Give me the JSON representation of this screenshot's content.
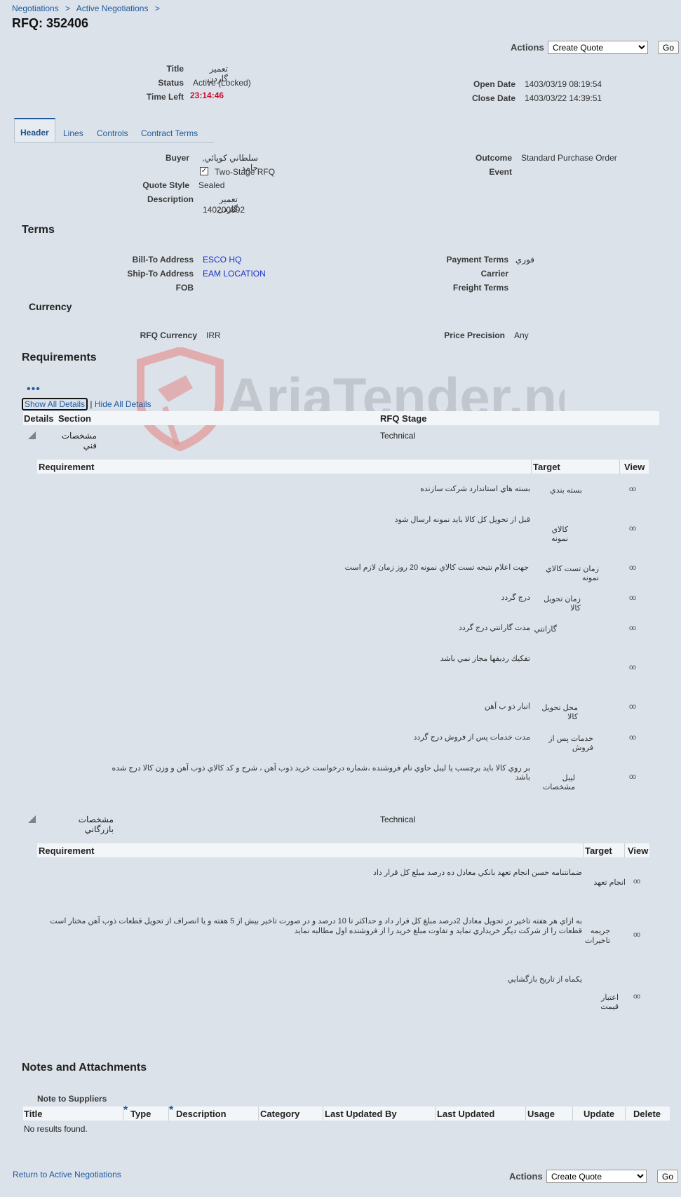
{
  "breadcrumb": [
    "Negotiations",
    "Active Negotiations"
  ],
  "breadcrumb_sep": ">",
  "page_title": "RFQ: 352406",
  "actions": {
    "label": "Actions",
    "selected": "Create Quote",
    "go": "Go"
  },
  "summary": {
    "title_label": "Title",
    "title_value": "تعمير گاردن",
    "status_label": "Status",
    "status_value": "Active (Locked)",
    "time_left_label": "Time Left",
    "time_left_value": "23:14:46",
    "open_date_label": "Open Date",
    "open_date_value": "1403/03/19 08:19:54",
    "close_date_label": "Close Date",
    "close_date_value": "1403/03/22 14:39:51"
  },
  "tabs": [
    "Header",
    "Lines",
    "Controls",
    "Contract Terms"
  ],
  "header": {
    "buyer_label": "Buyer",
    "buyer_value": "سلطاني كوپائي, حامد",
    "two_stage_label": "Two-Stage RFQ",
    "quote_style_label": "Quote Style",
    "quote_style_value": "Sealed",
    "description_label": "Description",
    "description_line1": "تعمير گاردن",
    "description_line2": "140200892",
    "outcome_label": "Outcome",
    "outcome_value": "Standard Purchase Order",
    "event_label": "Event"
  },
  "terms": {
    "title": "Terms",
    "bill_to_label": "Bill-To Address",
    "bill_to_value": "ESCO HQ",
    "ship_to_label": "Ship-To Address",
    "ship_to_value": "EAM LOCATION",
    "fob_label": "FOB",
    "payment_terms_label": "Payment Terms",
    "payment_terms_value": "فوري",
    "carrier_label": "Carrier",
    "freight_terms_label": "Freight Terms"
  },
  "currency": {
    "title": "Currency",
    "rfq_currency_label": "RFQ Currency",
    "rfq_currency_value": "IRR",
    "price_precision_label": "Price Precision",
    "price_precision_value": "Any"
  },
  "requirements": {
    "title": "Requirements",
    "show_all": "Show All Details",
    "hide_all": "Hide All Details",
    "pipe": "|",
    "col_details": "Details",
    "col_section": "Section",
    "col_stage": "RFQ Stage",
    "col_requirement": "Requirement",
    "col_target": "Target",
    "col_view": "View",
    "sections": [
      {
        "name": "مشخصات فني",
        "stage": "Technical",
        "rows": [
          {
            "req": "بسته بندي",
            "target": "بسته هاي استاندارد شركت سازنده"
          },
          {
            "req": "كالاي نمونه",
            "target": "قبل از تحويل كل كالا بايد نمونه ارسال شود"
          },
          {
            "req": "زمان تست كالاي نمونه",
            "target": "جهت اعلام نتيجه تست كالاي نمونه 20 روز زمان لازم است"
          },
          {
            "req": "زمان تحويل كالا",
            "target": "درج گردد"
          },
          {
            "req": "گارانتي",
            "target": "مدت گارانتي درج گردد"
          },
          {
            "req": "",
            "target": "تفكيك رديفها مجاز نمي باشد"
          },
          {
            "req": "محل تحويل كالا",
            "target": "انبار ذو ب آهن"
          },
          {
            "req": "خدمات پس از فروش",
            "target": "مدت خدمات پس از فروش درج گردد"
          },
          {
            "req": "ليبل مشخصات",
            "target": "بر روي كالا بايد برچسب يا ليبل حاوي نام فروشنده ،شماره درخواست خريد ذوب آهن ، شرح و كد كالاي ذوب آهن و وزن كالا درج شده باشد"
          }
        ]
      },
      {
        "name": "مشخصات بازرگاني",
        "stage": "Technical",
        "rows": [
          {
            "req": "انجام تعهد",
            "target": "ضمانتنامه حسن انجام تعهد بانكي معادل ده درصد مبلغ كل قرار داد"
          },
          {
            "req": "جريمه تاخيرات",
            "target": "به ازاي هر هفته تاخير در تحويل معادل 2درصد مبلغ كل قرار داد و حداكثر تا 10 درصد و در صورت تاخير بيش از 5 هفته و يا انصراف از تحويل قطعات ذوب آهن مختار است قطعات را از شركت ديگر خريداري نمايد و تفاوت مبلغ خريد را از فروشنده اول مطالبه نمايد"
          },
          {
            "req": "اعتبار قيمت",
            "target": "يكماه از تاريخ بازگشايي"
          }
        ]
      }
    ]
  },
  "notes": {
    "title": "Notes and Attachments",
    "note_to_suppliers": "Note to Suppliers",
    "columns": [
      "Title",
      "Type",
      "Description",
      "Category",
      "Last Updated By",
      "Last Updated",
      "Usage",
      "Update",
      "Delete"
    ],
    "required_mark": "*",
    "empty": "No results found."
  },
  "footer": {
    "return_link": "Return to Active Negotiations"
  },
  "watermark_text": "AriaTender.neT"
}
